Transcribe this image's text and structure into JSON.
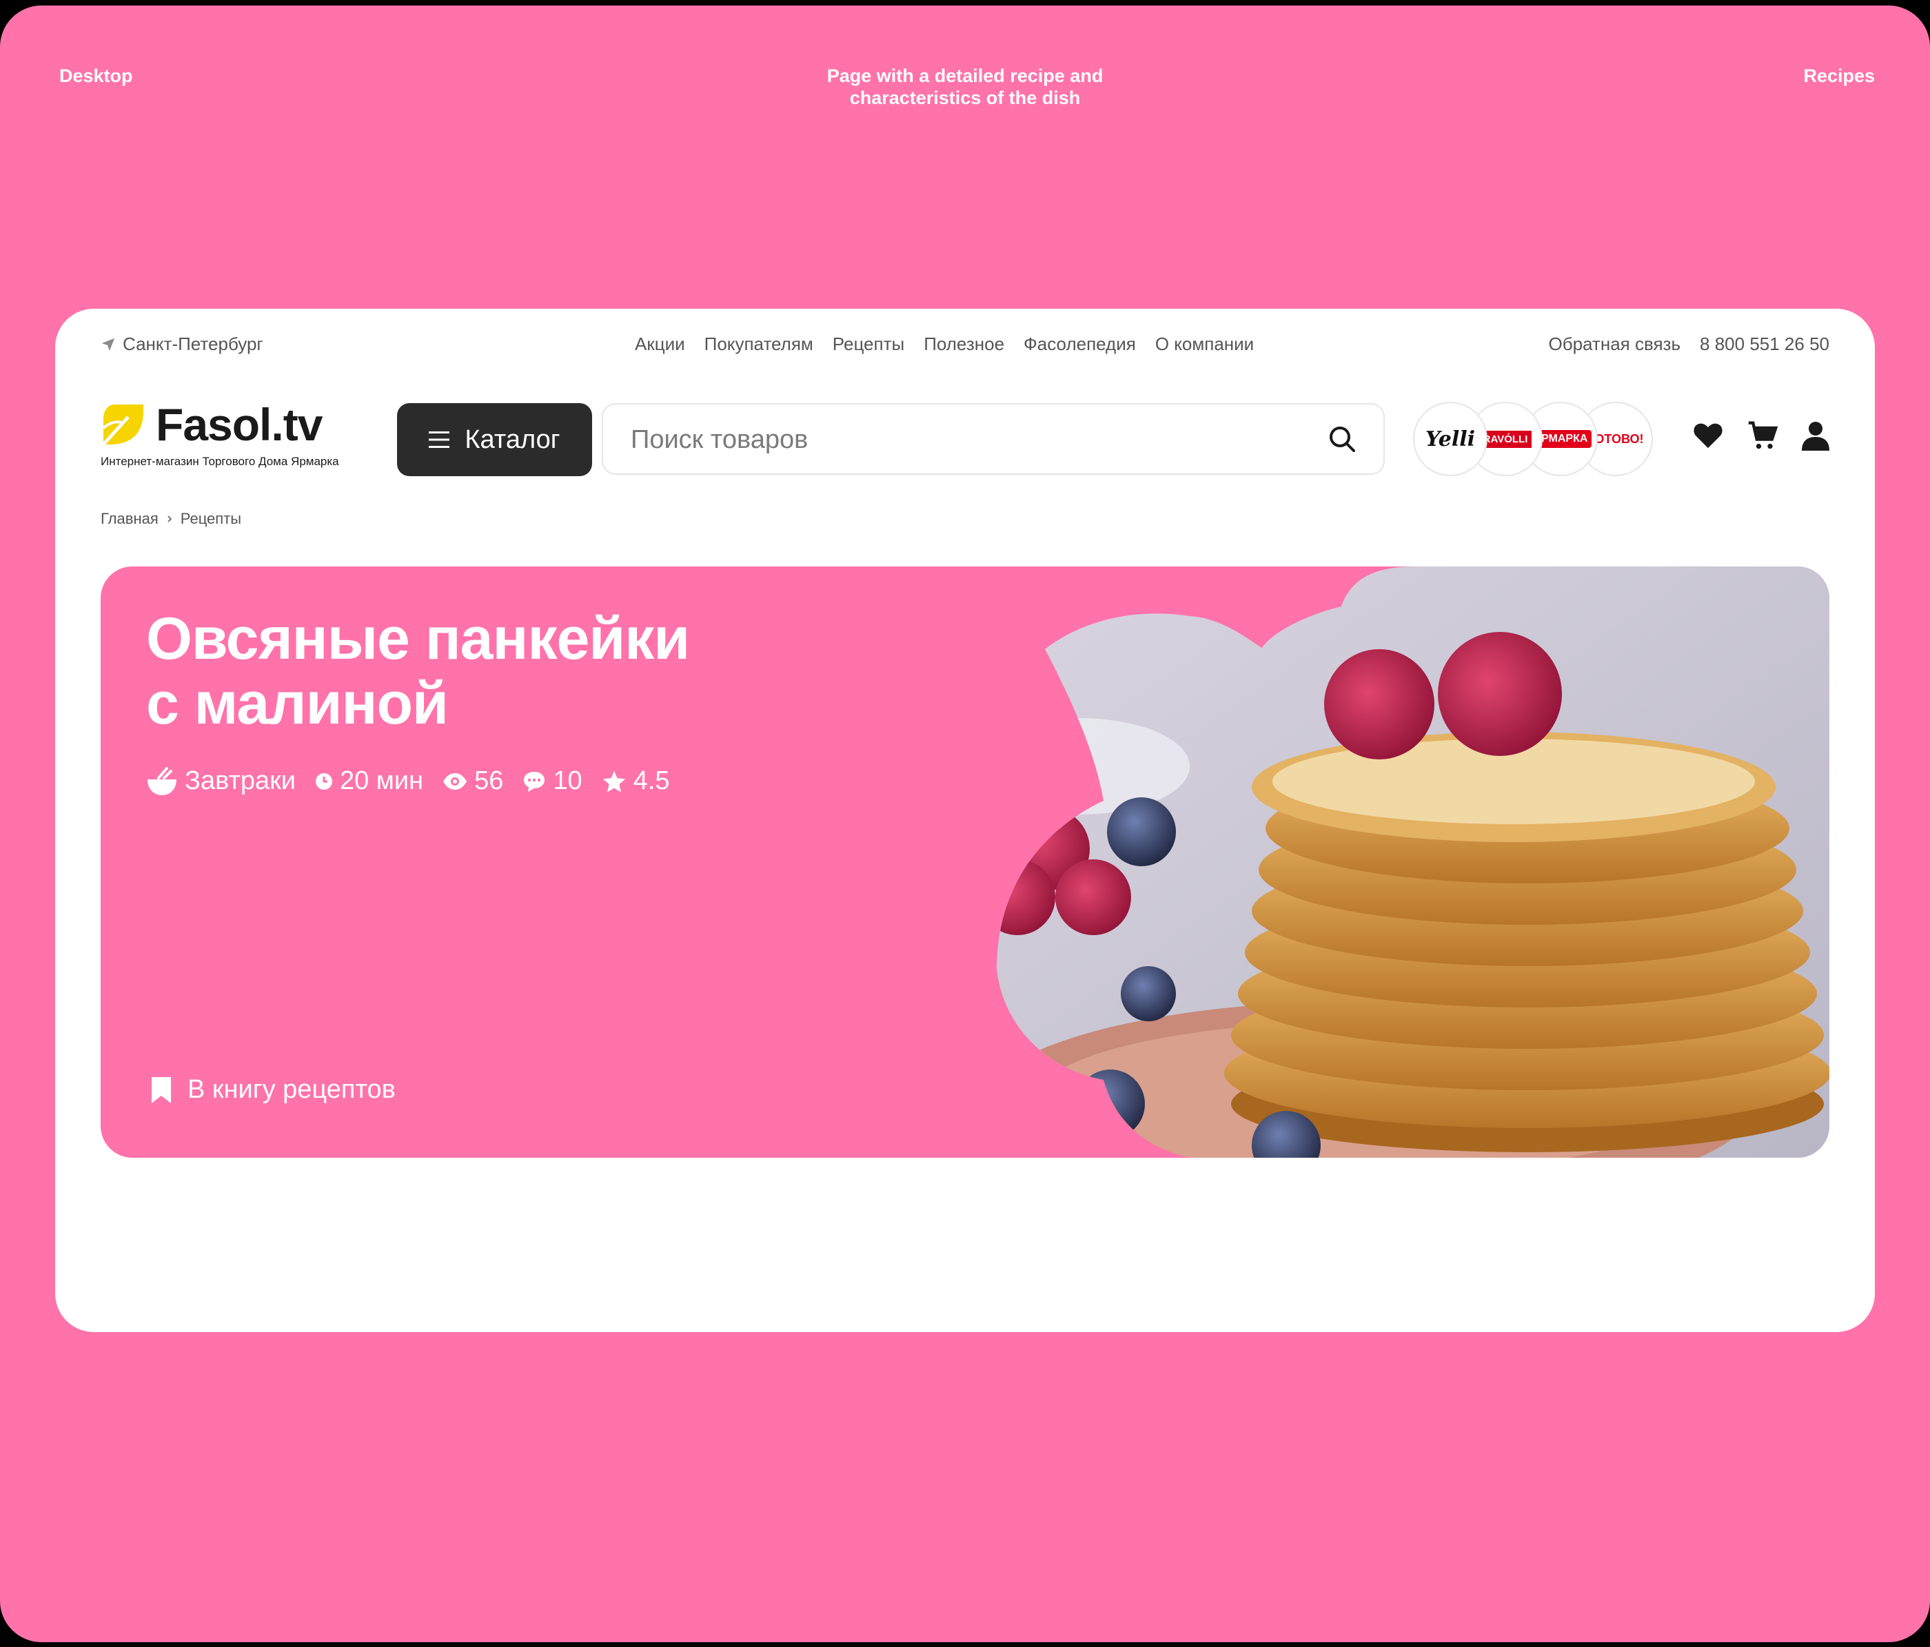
{
  "captions": {
    "left": "Desktop",
    "center_line1": "Page with a detailed recipe and",
    "center_line2": "characteristics of the dish",
    "right": "Recipes"
  },
  "topbar": {
    "city": "Санкт-Петербург",
    "nav": [
      "Акции",
      "Покупателям",
      "Рецепты",
      "Полезное",
      "Фасолепедия",
      "О компании"
    ],
    "feedback": "Обратная связь",
    "phone": "8 800 551 26 50"
  },
  "header": {
    "logo_text": "Fasol.tv",
    "logo_subtitle": "Интернет-магазин Торгового Дома Ярмарка",
    "catalog_label": "Каталог",
    "search_placeholder": "Поиск товаров",
    "brands": [
      "Yelli",
      "RAVÓLLI",
      "ЯРМАРКА",
      "ГОТОВО!"
    ]
  },
  "breadcrumb": {
    "home": "Главная",
    "current": "Рецепты"
  },
  "recipe": {
    "title_line1": "Овсяные панкейки",
    "title_line2": "с малиной",
    "category": "Завтраки",
    "time": "20 мин",
    "views": "56",
    "comments": "10",
    "rating": "4.5",
    "bookmark_label": "В книгу рецептов"
  },
  "colors": {
    "accent": "#ff72aa",
    "dark": "#2b2b2b",
    "logo_yellow": "#f5d400"
  },
  "icons": [
    "location-arrow-icon",
    "menu-icon",
    "search-icon",
    "heart-icon",
    "cart-icon",
    "user-icon",
    "bowl-icon",
    "clock-icon",
    "eye-icon",
    "comment-icon",
    "star-icon",
    "bookmark-icon"
  ]
}
